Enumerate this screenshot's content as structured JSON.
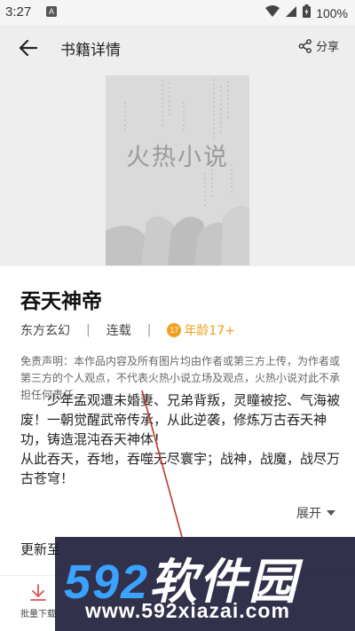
{
  "status": {
    "time": "3:27",
    "notif": "A",
    "battery": "100%"
  },
  "nav": {
    "title": "书籍详情",
    "share_label": "分享"
  },
  "cover": {
    "text": "火热小说"
  },
  "book": {
    "title": "吞天神帝",
    "category": "东方玄幻",
    "status": "连载",
    "age_label": "年龄17+",
    "age_icon": "17"
  },
  "disclaimer": "免责声明：本作品内容及所有图片均由作者或第三方上传，为作者或第三方的个人观点，不代表火热小说立场及观点，火热小说对此不承担任何责任。",
  "intro": {
    "line1": "少年孟观遭未婚妻、兄弟背叛，灵瞳被挖、气海被废！一朝觉醒武帝传承，从此逆袭，修炼万古吞天神功，铸造混沌吞天神体！",
    "line2": "从此吞天，吞地，吞噬无尽寰宇；战神，战魔，战尽万古苍穹！"
  },
  "expand_label": "展开",
  "update_label": "更新至",
  "batch_label": "批量下载",
  "watermark": {
    "brand_num": "592",
    "brand_text": "软件园",
    "url": "www.592xiazai.com"
  },
  "colors": {
    "accent": "#f0a020",
    "watermark_blue": "#3aa3ff"
  }
}
